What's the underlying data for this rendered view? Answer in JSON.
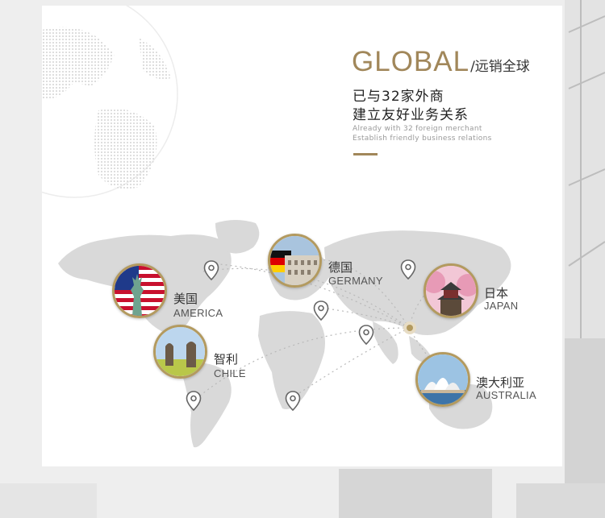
{
  "headline": {
    "global": "GLOBAL",
    "global_suffix": "/远销全球",
    "cn_line1": "已与32家外商",
    "cn_line2": "建立友好业务关系",
    "en_line1": "Already with 32 foreign merchant",
    "en_line2": "Establish friendly business relations"
  },
  "countries": [
    {
      "cn": "美国",
      "en": "AMERICA"
    },
    {
      "cn": "德国",
      "en": "GERMANY"
    },
    {
      "cn": "日本",
      "en": "JAPAN"
    },
    {
      "cn": "智利",
      "en": "CHILE"
    },
    {
      "cn": "澳大利亚",
      "en": "AUSTRALIA"
    }
  ],
  "colors": {
    "accent": "#a1875a",
    "ring": "#b39a5f",
    "map": "#d9d9d9"
  },
  "icons": [
    "location-pin-icon",
    "globe-icon",
    "world-map-icon"
  ]
}
